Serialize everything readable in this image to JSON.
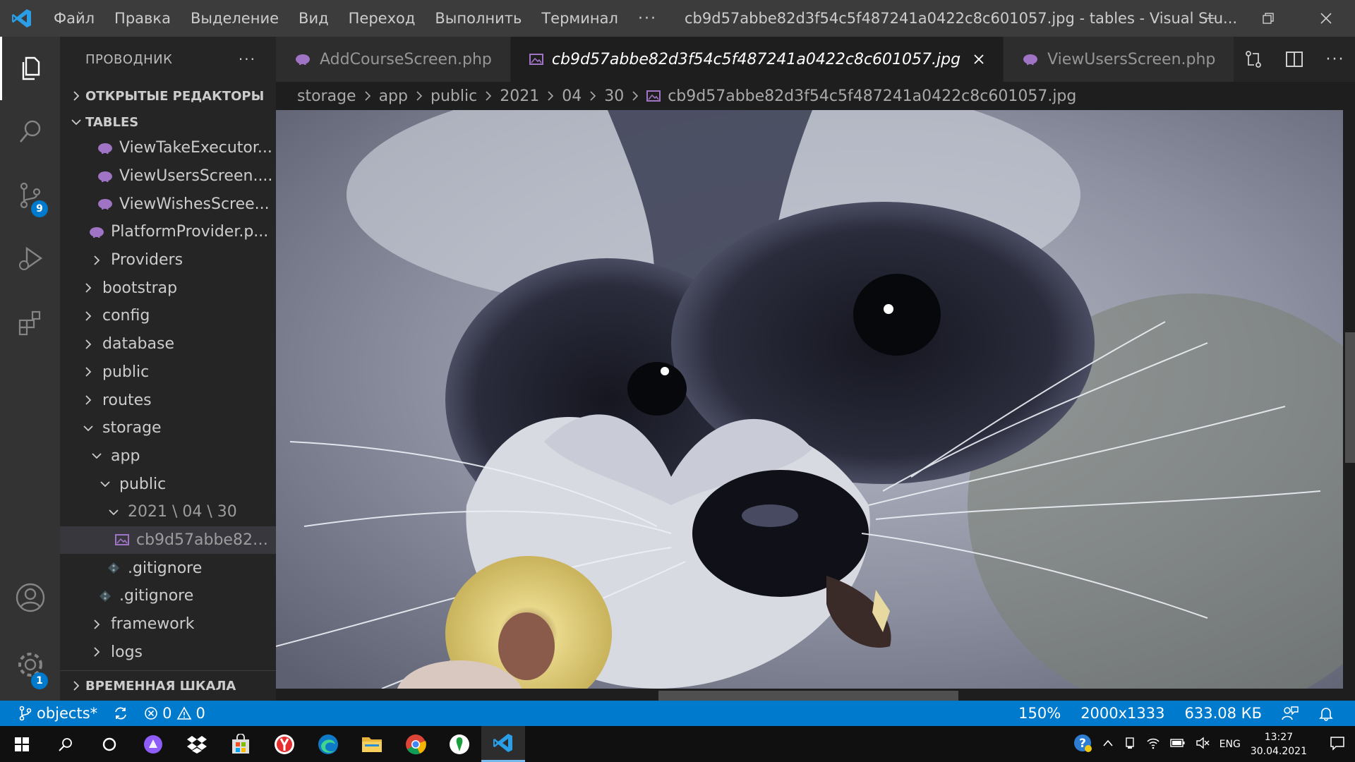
{
  "titlebar": {
    "menu": [
      "Файл",
      "Правка",
      "Выделение",
      "Вид",
      "Переход",
      "Выполнить",
      "Терминал"
    ],
    "more": "···",
    "window_title": "cb9d57abbe82d3f54c5f487241a0422c8c601057.jpg - tables - Visual Stu..."
  },
  "activitybar": {
    "scm_badge": "9",
    "settings_badge": "1"
  },
  "sidebar": {
    "title": "ПРОВОДНИК",
    "more": "···",
    "open_editors": "ОТКРЫТЫЕ РЕДАКТОРЫ",
    "workspace": "TABLES",
    "items": [
      {
        "label": "ViewTakeExecutor...",
        "type": "php",
        "indent": 3
      },
      {
        "label": "ViewUsersScreen....",
        "type": "php",
        "indent": 3
      },
      {
        "label": "ViewWishesScree...",
        "type": "php",
        "indent": 3
      },
      {
        "label": "PlatformProvider.p...",
        "type": "php",
        "indent": 2
      },
      {
        "label": "Providers",
        "type": "folder-closed",
        "indent": 2
      },
      {
        "label": "bootstrap",
        "type": "folder-closed",
        "indent": 1
      },
      {
        "label": "config",
        "type": "folder-closed",
        "indent": 1
      },
      {
        "label": "database",
        "type": "folder-closed",
        "indent": 1
      },
      {
        "label": "public",
        "type": "folder-closed",
        "indent": 1
      },
      {
        "label": "routes",
        "type": "folder-closed",
        "indent": 1
      },
      {
        "label": "storage",
        "type": "folder-open",
        "indent": 1
      },
      {
        "label": "app",
        "type": "folder-open",
        "indent": 2
      },
      {
        "label": "public",
        "type": "folder-open",
        "indent": 3
      },
      {
        "label": "2021 \\ 04 \\ 30",
        "type": "folder-open-dim",
        "indent": 4
      },
      {
        "label": "cb9d57abbe82d...",
        "type": "image",
        "indent": 5,
        "selected": true
      },
      {
        "label": ".gitignore",
        "type": "git",
        "indent": 4
      },
      {
        "label": ".gitignore",
        "type": "git",
        "indent": 3
      },
      {
        "label": "framework",
        "type": "folder-closed",
        "indent": 2
      },
      {
        "label": "logs",
        "type": "folder-closed",
        "indent": 2
      }
    ],
    "timeline": "ВРЕМЕННАЯ ШКАЛА"
  },
  "tabs": [
    {
      "label": "AddCourseScreen.php",
      "type": "php",
      "active": false
    },
    {
      "label": "cb9d57abbe82d3f54c5f487241a0422c8c601057.jpg",
      "type": "image",
      "active": true
    },
    {
      "label": "ViewUsersScreen.php",
      "type": "php",
      "active": false
    }
  ],
  "breadcrumb": [
    "storage",
    "app",
    "public",
    "2021",
    "04",
    "30",
    "cb9d57abbe82d3f54c5f487241a0422c8c601057.jpg"
  ],
  "statusbar": {
    "branch": "objects*",
    "errors": "0",
    "warnings": "0",
    "zoom": "150%",
    "dimensions": "2000x1333",
    "size": "633.08 КБ"
  },
  "taskbar": {
    "language": "ENG",
    "time": "13:27",
    "date": "30.04.2021"
  },
  "colors": {
    "accent": "#007acc",
    "php_icon": "#a074c4"
  }
}
